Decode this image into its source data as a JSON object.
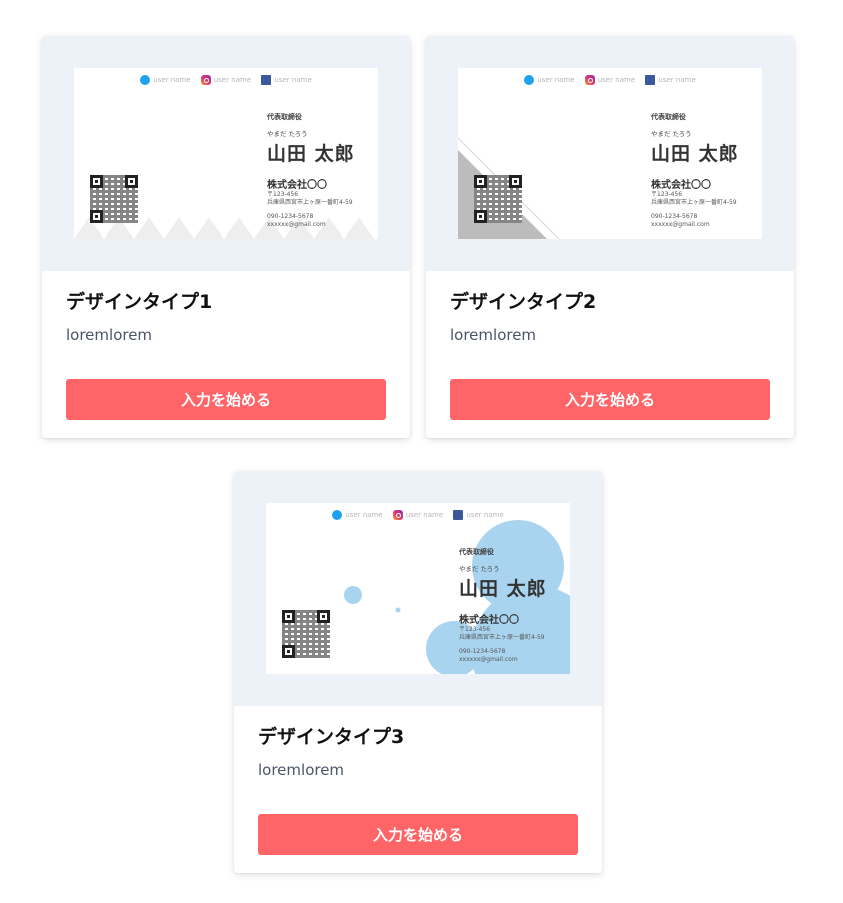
{
  "cards": [
    {
      "title": "デザインタイプ1",
      "description": "loremlorem",
      "button_label": "入力を始める",
      "preview": {
        "design": "triangles",
        "social": [
          "user name",
          "user name",
          "user name"
        ],
        "position": "代表取締役",
        "kana": "やまだ たろう",
        "name": "山田 太郎",
        "company": "株式会社〇〇",
        "postal": "〒123-456",
        "address": "兵庫県西宮市上ヶ原一番町4-59",
        "phone": "090-1234-5678",
        "email": "xxxxxx@gmail.com"
      }
    },
    {
      "title": "デザインタイプ2",
      "description": "loremlorem",
      "button_label": "入力を始める",
      "preview": {
        "design": "diagonal",
        "social": [
          "user name",
          "user name",
          "user name"
        ],
        "position": "代表取締役",
        "kana": "やまだ たろう",
        "name": "山田 太郎",
        "company": "株式会社〇〇",
        "postal": "〒123-456",
        "address": "兵庫県西宮市上ヶ原一番町4-59",
        "phone": "090-1234-5678",
        "email": "xxxxxx@gmail.com"
      }
    },
    {
      "title": "デザインタイプ3",
      "description": "loremlorem",
      "button_label": "入力を始める",
      "preview": {
        "design": "bubbles",
        "social": [
          "user name",
          "user name",
          "user name"
        ],
        "position": "代表取締役",
        "kana": "やまだ たろう",
        "name": "山田 太郎",
        "company": "株式会社〇〇",
        "postal": "〒123-456",
        "address": "兵庫県西宮市上ヶ原一番町4-59",
        "phone": "090-1234-5678",
        "email": "xxxxxx@gmail.com"
      }
    }
  ],
  "colors": {
    "button": "#ff6467",
    "thumb_background": "#edf2f8",
    "bubble": "#a9d4f0",
    "triangle": "#eeeeee",
    "diagonal": "#bcbcbc"
  },
  "icons": [
    "twitter-icon",
    "instagram-icon",
    "facebook-icon"
  ]
}
